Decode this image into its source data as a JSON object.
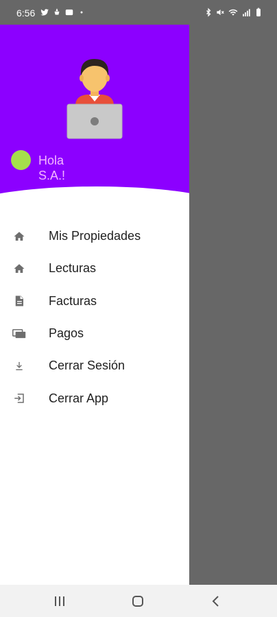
{
  "status_bar": {
    "time": "6:56",
    "left_icons": [
      "twitter-icon",
      "notification-icon",
      "app-icon"
    ],
    "right_icons": [
      "bluetooth-icon",
      "mute-icon",
      "wifi-icon",
      "signal-icon",
      "battery-icon"
    ]
  },
  "drawer": {
    "header_color": "#8c00ff",
    "greeting": "Hola\nS.A.!",
    "status_dot_color": "#a5e04b",
    "menu": [
      {
        "label": "Mis Propiedades",
        "icon": "home-icon"
      },
      {
        "label": "Lecturas",
        "icon": "home-icon"
      },
      {
        "label": "Facturas",
        "icon": "document-icon"
      },
      {
        "label": "Pagos",
        "icon": "payment-icon"
      },
      {
        "label": "Cerrar Sesión",
        "icon": "download-icon"
      },
      {
        "label": "Cerrar App",
        "icon": "exit-icon"
      }
    ]
  },
  "nav_bar": {
    "buttons": [
      "recents-button",
      "home-button",
      "back-button"
    ]
  }
}
